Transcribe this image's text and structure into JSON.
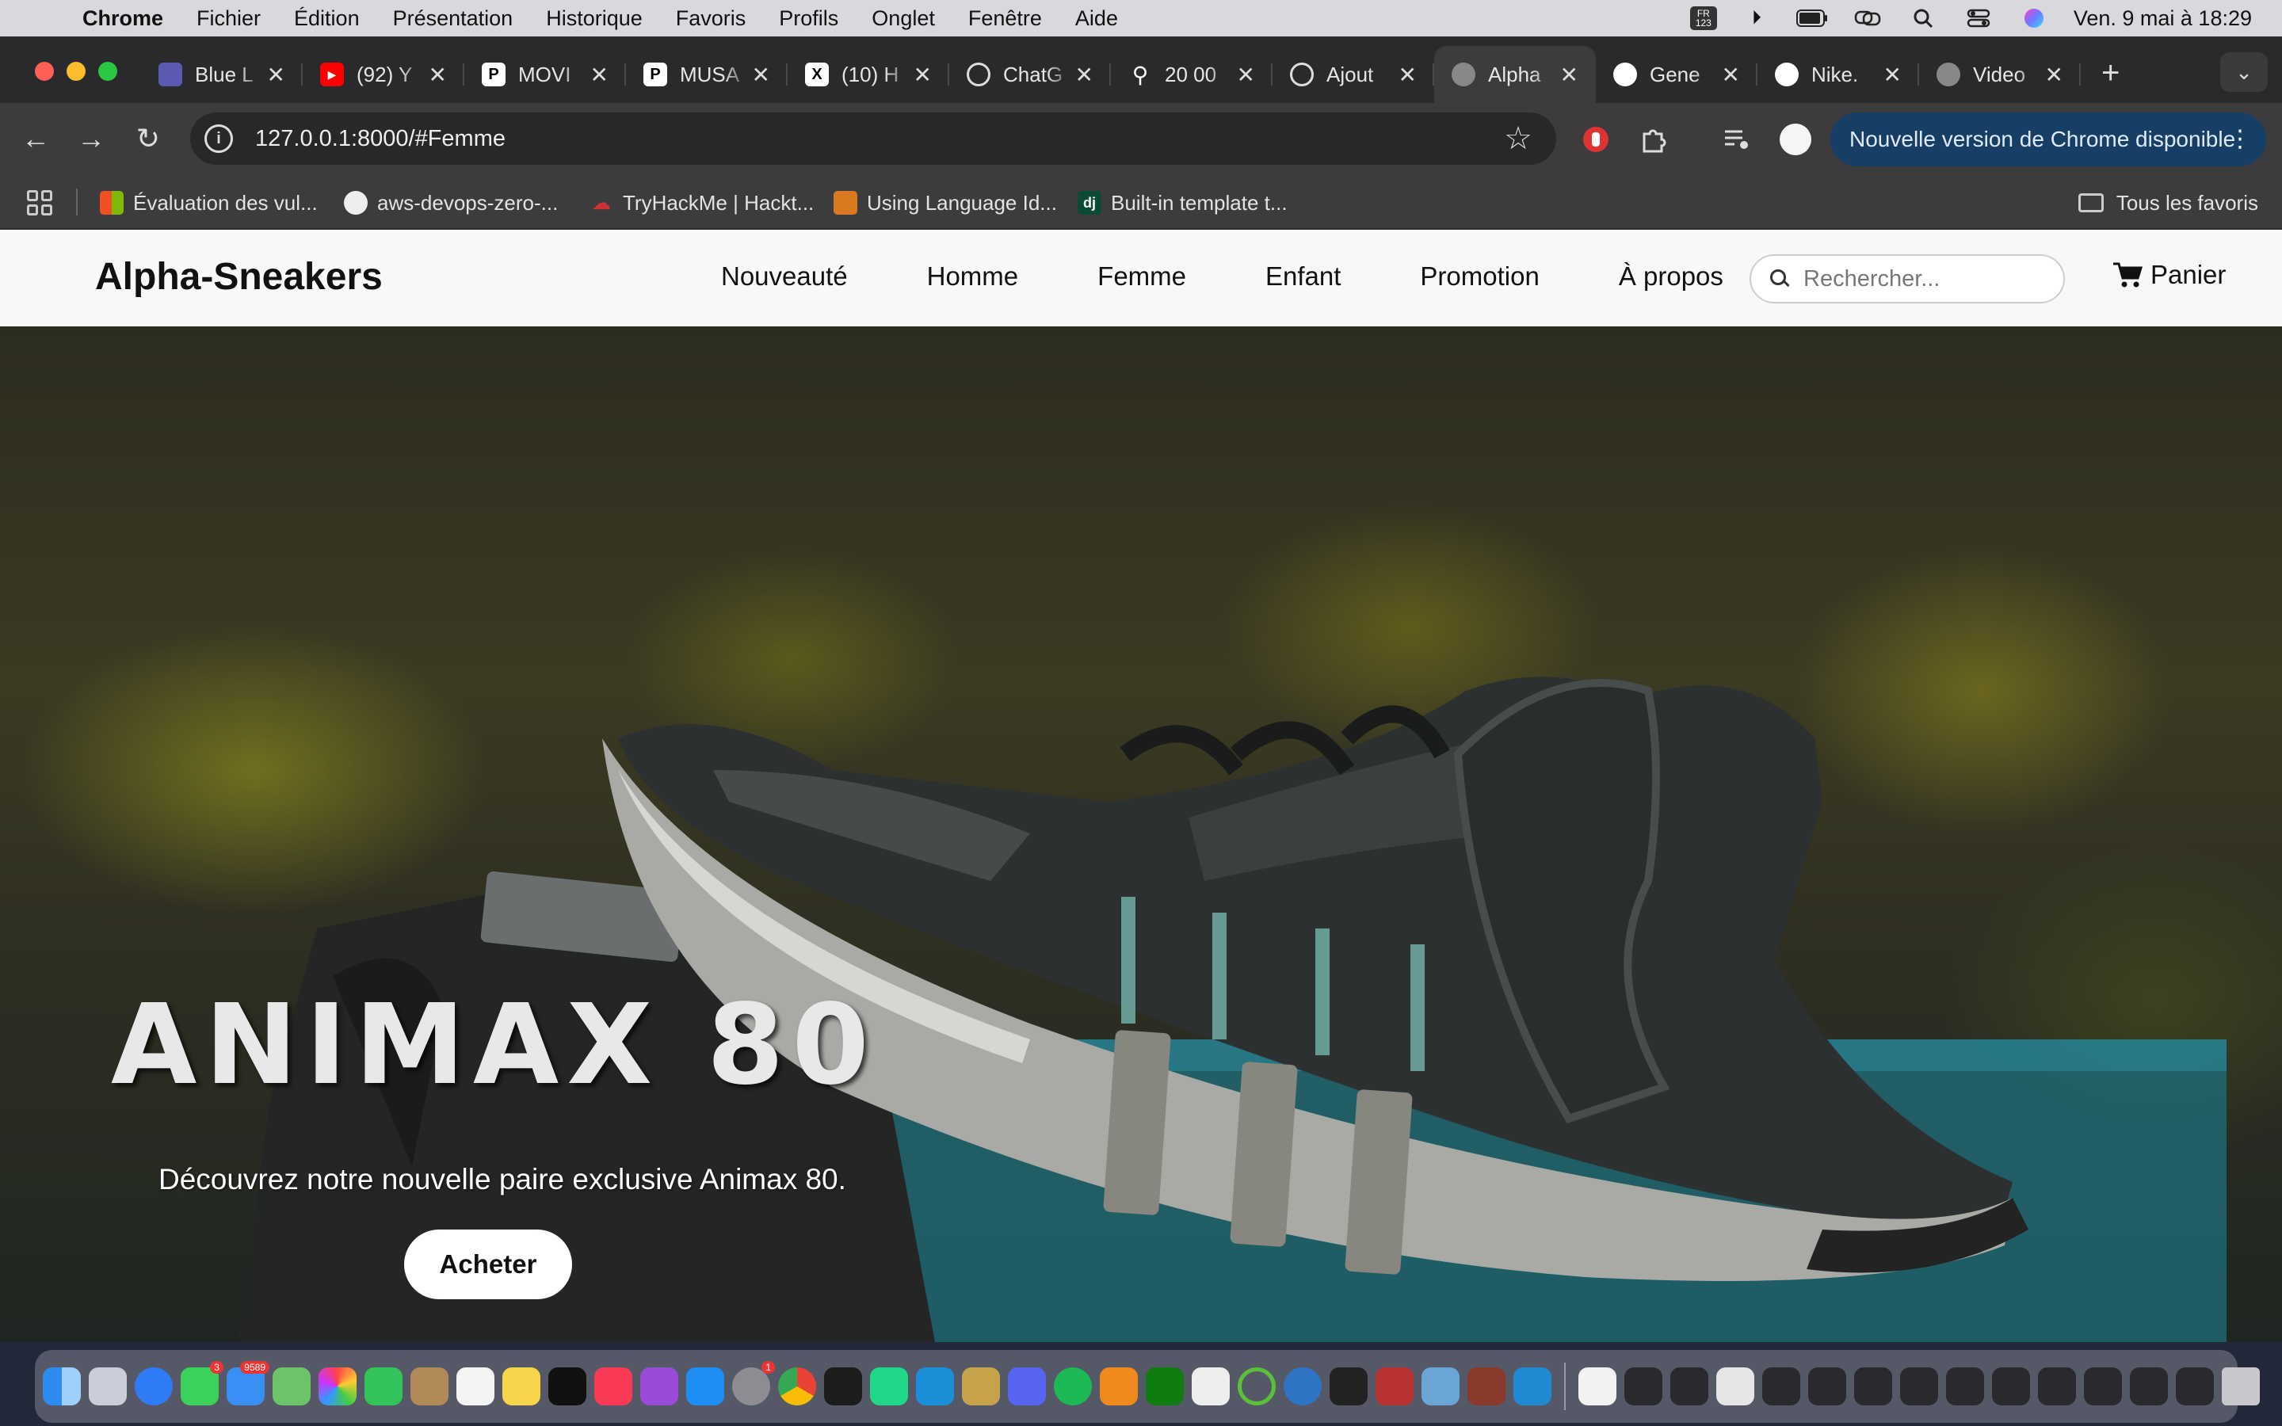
{
  "menubar": {
    "app_name": "Chrome",
    "items": [
      "Fichier",
      "Édition",
      "Présentation",
      "Historique",
      "Favoris",
      "Profils",
      "Onglet",
      "Fenêtre",
      "Aide"
    ],
    "input_source": "FR 123",
    "clock": "Ven. 9 mai à  18:29"
  },
  "tabs": [
    {
      "title": "Blue L",
      "icon": "image-favicon"
    },
    {
      "title": "(92) Y",
      "icon": "youtube-favicon"
    },
    {
      "title": "MOVI",
      "icon": "patreon-favicon"
    },
    {
      "title": "MUSA",
      "icon": "patreon-favicon"
    },
    {
      "title": "(10) H",
      "icon": "x-favicon"
    },
    {
      "title": "ChatG",
      "icon": "openai-favicon"
    },
    {
      "title": "20 00",
      "icon": "link-favicon"
    },
    {
      "title": "Ajout",
      "icon": "openai-favicon"
    },
    {
      "title": "Alpha",
      "icon": "globe-favicon",
      "active": true
    },
    {
      "title": "Gene",
      "icon": "github-favicon"
    },
    {
      "title": "Nike.",
      "icon": "nike-favicon"
    },
    {
      "title": "Video",
      "icon": "globe-favicon"
    }
  ],
  "toolbar": {
    "url": "127.0.0.1:8000/#Femme",
    "update_label": "Nouvelle version de Chrome disponible"
  },
  "bookmarks": [
    {
      "label": "Évaluation des vul...",
      "icon": "microsoft-icon"
    },
    {
      "label": "aws-devops-zero-...",
      "icon": "github-icon"
    },
    {
      "label": "TryHackMe | Hackt...",
      "icon": "cloud-icon"
    },
    {
      "label": "Using Language Id...",
      "icon": "dev-icon"
    },
    {
      "label": "Built-in template t...",
      "icon": "django-icon"
    }
  ],
  "bookmarks_all": "Tous les favoris",
  "site": {
    "brand": "Alpha-Sneakers",
    "nav": [
      "Nouveauté",
      "Homme",
      "Femme",
      "Enfant",
      "Promotion",
      "À propos"
    ],
    "search_placeholder": "Rechercher...",
    "cart_label": "Panier",
    "hero": {
      "title": "ANIMAX 80",
      "subtitle": "Découvrez notre nouvelle paire exclusive Animax 80.",
      "button": "Acheter"
    }
  },
  "colors": {
    "update_pill_bg": "#173f66",
    "page_bg": "#f8f8f6",
    "button_bg": "#ffffff"
  }
}
